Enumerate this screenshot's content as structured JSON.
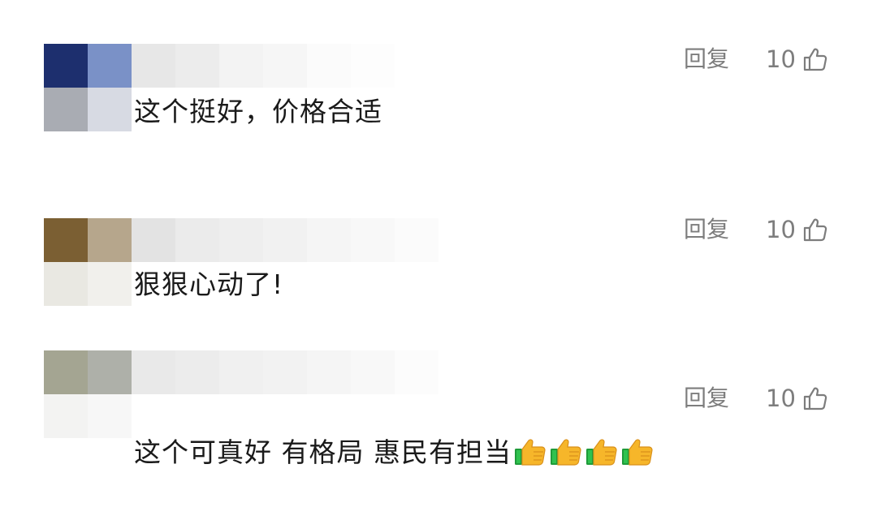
{
  "comments": [
    {
      "content": "这个挺好，价格合适",
      "reply_label": "回复",
      "like_count": "10",
      "emoji_count": 0,
      "avatar_colors": [
        "#1d2f6e",
        "#7a91c7",
        "#a9acb3",
        "#d7dae3"
      ],
      "name_mosaic_colors": [
        "#e7e7e7",
        "#ececec",
        "#f3f3f3",
        "#f6f6f6",
        "#fbfbfb",
        "#fdfdfd",
        "#ffffff"
      ]
    },
    {
      "content": "狠狠心动了!",
      "reply_label": "回复",
      "like_count": "10",
      "emoji_count": 0,
      "avatar_colors": [
        "#7b5f33",
        "#b6a68c",
        "#e9e8e2",
        "#f1f0ec"
      ],
      "name_mosaic_colors": [
        "#e3e3e3",
        "#ebebeb",
        "#eeeeee",
        "#f1f1f1",
        "#f5f5f5",
        "#f8f8f8",
        "#fbfbfb"
      ]
    },
    {
      "content": "这个可真好 有格局 惠民有担当",
      "reply_label": "回复",
      "like_count": "10",
      "emoji_count": 4,
      "emoji_name": "thumbs-up-emoji",
      "avatar_colors": [
        "#a4a592",
        "#aeb0a9",
        "#f3f3f2",
        "#f7f7f7"
      ],
      "name_mosaic_colors": [
        "#e9e9e9",
        "#ececec",
        "#f0f0f0",
        "#f2f2f2",
        "#f5f5f5",
        "#f8f8f8",
        "#fcfcfc"
      ]
    }
  ],
  "icons": {
    "like": "thumbs-up-outline-icon"
  }
}
